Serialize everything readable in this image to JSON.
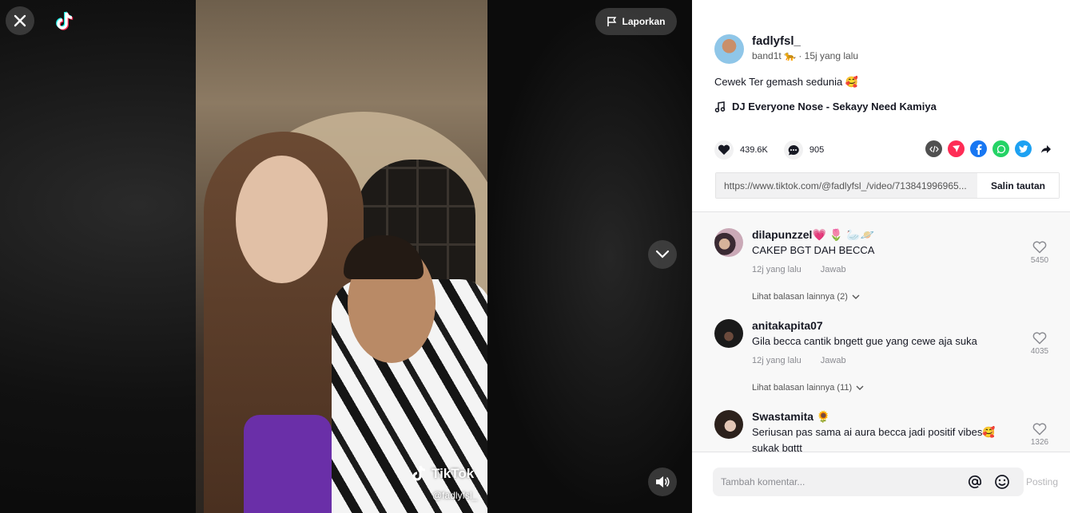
{
  "viewer": {
    "watermark": "TikTok",
    "watermark_handle": "@fadlyfsl_",
    "report_label": "Laporkan"
  },
  "post": {
    "username": "fadlyfsl_",
    "nickname": "band1t 🐆",
    "time": "· 15j yang lalu",
    "caption": "Cewek Ter gemash sedunia 🥰",
    "music": "DJ Everyone Nose - Sekayy Need Kamiya",
    "likes": "439.6K",
    "comments_count": "905",
    "link": "https://www.tiktok.com/@fadlyfsl_/video/713841996965...",
    "copy_label": "Salin tautan"
  },
  "comments": [
    {
      "name": "dilapunzzel💗 🌷 🦢🪐",
      "text": "CAKEP BGT DAH BECCA",
      "time": "12j yang lalu",
      "reply": "Jawab",
      "likes": "5450",
      "more": "Lihat balasan lainnya (2)"
    },
    {
      "name": "anitakapita07",
      "text": "Gila becca cantik bngett gue yang cewe aja suka",
      "time": "12j yang lalu",
      "reply": "Jawab",
      "likes": "4035",
      "more": "Lihat balasan lainnya (11)"
    },
    {
      "name": "Swastamita 🌻",
      "text": "Seriusan pas sama ai aura becca jadi positif vibes🥰",
      "text2": "sukak bgttt",
      "likes": "1326"
    }
  ],
  "composer": {
    "placeholder": "Tambah komentar...",
    "post_label": "Posting"
  },
  "colors": {
    "brand_red": "#fe2c55",
    "brand_cyan": "#25f4ee",
    "facebook": "#1877f2",
    "whatsapp": "#25d366",
    "twitter": "#1da1f2"
  }
}
